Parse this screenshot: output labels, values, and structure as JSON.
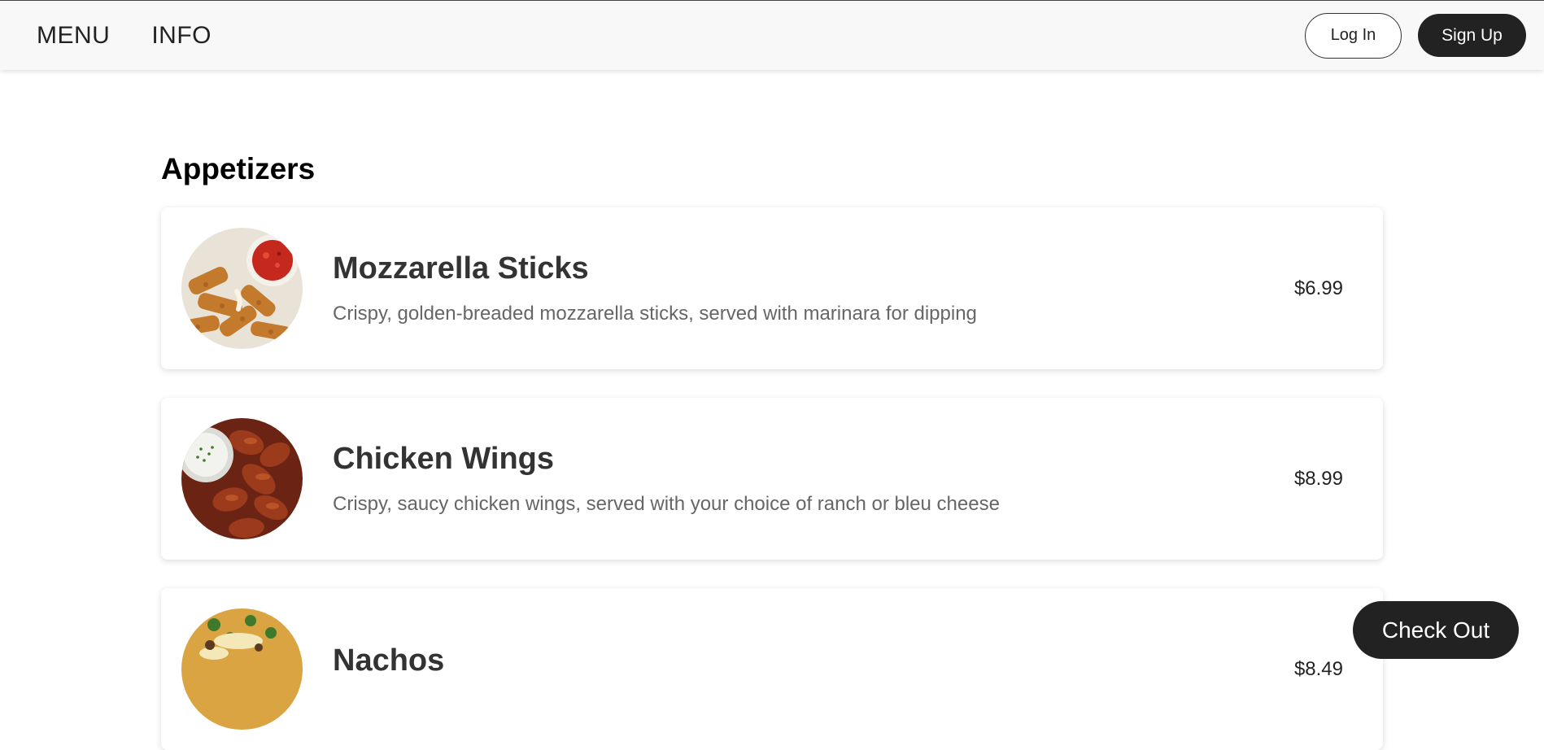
{
  "nav": {
    "menu_label": "MENU",
    "info_label": "INFO",
    "login_label": "Log In",
    "signup_label": "Sign Up"
  },
  "section": {
    "title": "Appetizers"
  },
  "items": [
    {
      "name": "Mozzarella Sticks",
      "description": "Crispy, golden-breaded mozzarella sticks, served with marinara for dipping",
      "price": "$6.99",
      "image_icon": "mozzarella-sticks-photo"
    },
    {
      "name": "Chicken Wings",
      "description": "Crispy, saucy chicken wings, served with your choice of ranch or bleu cheese",
      "price": "$8.99",
      "image_icon": "chicken-wings-photo"
    },
    {
      "name": "Nachos",
      "description": "",
      "price": "$8.49",
      "image_icon": "nachos-photo"
    }
  ],
  "checkout": {
    "label": "Check Out"
  },
  "colors": {
    "dark_button": "#222222",
    "navbar_bg": "#f8f8f8",
    "description_text": "#666666"
  }
}
